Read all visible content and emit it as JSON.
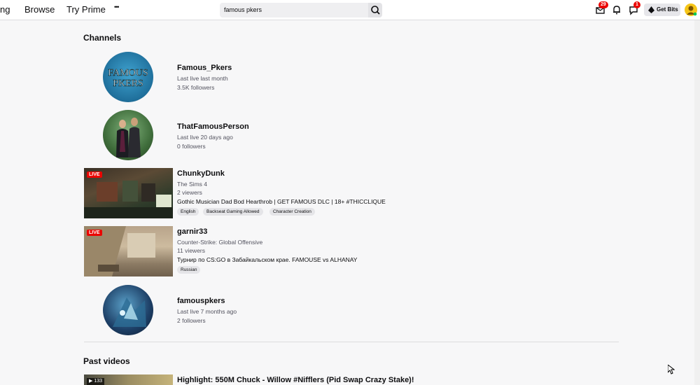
{
  "nav": {
    "following_partial": "ng",
    "browse": "Browse",
    "try_prime": "Try Prime",
    "more": "•••"
  },
  "search": {
    "value": "famous pkers"
  },
  "header": {
    "inbox_badge": "29",
    "whispers_badge": "1",
    "get_bits_label": "Get Bits"
  },
  "sections": {
    "channels_title": "Channels",
    "past_videos_title": "Past videos"
  },
  "channels": [
    {
      "name": "Famous_Pkers",
      "line1": "Last live last month",
      "line2": "3.5K followers"
    },
    {
      "name": "ThatFamousPerson",
      "line1": "Last live 20 days ago",
      "line2": "0 followers"
    },
    {
      "name": "ChunkyDunk",
      "category": "The Sims 4",
      "viewers": "2 viewers",
      "title": "Gothic Musician Dad Bod Hearthrob | GET FAMOUS DLC | 18+ #THICCLIQUE",
      "tags": [
        "English",
        "Backseat Gaming Allowed",
        "Character Creation"
      ],
      "live": "LIVE"
    },
    {
      "name": "garnir33",
      "category": "Counter-Strike: Global Offensive",
      "viewers": "11 viewers",
      "title": "Турнир по CS:GO в Забайкальском крае. FAMOUSE vs ALHANAY",
      "tags": [
        "Russian"
      ],
      "live": "LIVE"
    },
    {
      "name": "famouspkers",
      "line1": "Last live 7 months ago",
      "line2": "2 followers"
    }
  ],
  "avatar_texts": {
    "famous": "FAMOUS",
    "pkers": "PKERS"
  },
  "past_videos": [
    {
      "title": "Highlight: 550M Chuck - Willow #Nifflers (Pid Swap Crazy Stake)!",
      "views": "133"
    }
  ],
  "colors": {
    "accent": "#9147ff",
    "live": "#eb0400",
    "badge": "#eb0400"
  }
}
